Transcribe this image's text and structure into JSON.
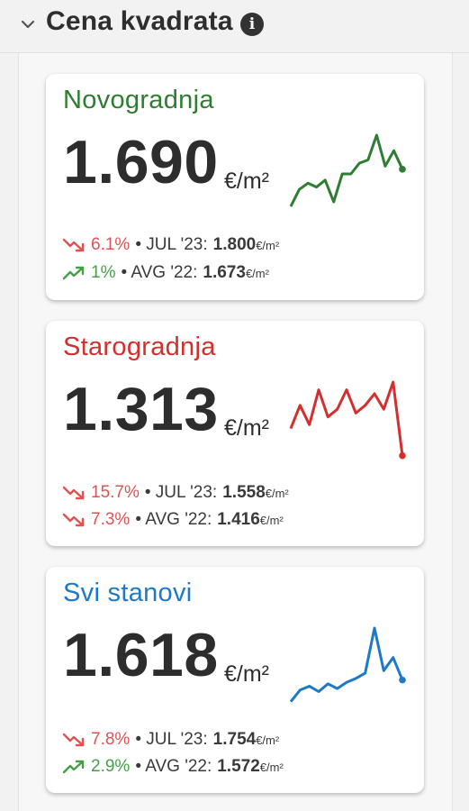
{
  "header": {
    "title": "Cena kvadrata",
    "info_glyph": "i"
  },
  "unit_label": "€/m²",
  "unit_small": "€/m²",
  "cards": [
    {
      "title": "Novogradnja",
      "color": "#2e7d32",
      "price": "1.690",
      "sparkline": [
        0.08,
        0.3,
        0.38,
        0.33,
        0.42,
        0.14,
        0.5,
        0.5,
        0.64,
        0.68,
        1.0,
        0.6,
        0.8,
        0.56
      ],
      "stats": [
        {
          "trend": "down",
          "trend_color": "#e05252",
          "pct": "6.1%",
          "label": "• JUL '23:",
          "value": "1.800"
        },
        {
          "trend": "up",
          "trend_color": "#43a047",
          "pct": "1%",
          "label": "• AVG '22:",
          "value": "1.673"
        }
      ]
    },
    {
      "title": "Starogradnja",
      "color": "#d32f2f",
      "price": "1.313",
      "sparkline": [
        0.4,
        0.7,
        0.45,
        0.9,
        0.55,
        0.65,
        0.9,
        0.6,
        0.7,
        0.85,
        0.65,
        1.0,
        0.05
      ],
      "stats": [
        {
          "trend": "down",
          "trend_color": "#e05252",
          "pct": "15.7%",
          "label": "• JUL '23:",
          "value": "1.558"
        },
        {
          "trend": "down",
          "trend_color": "#e05252",
          "pct": "7.3%",
          "label": "• AVG '22:",
          "value": "1.416"
        }
      ]
    },
    {
      "title": "Svi stanovi",
      "color": "#1e7ac8",
      "price": "1.618",
      "sparkline": [
        0.05,
        0.2,
        0.25,
        0.18,
        0.28,
        0.22,
        0.3,
        0.35,
        0.42,
        1.0,
        0.45,
        0.62,
        0.33
      ],
      "stats": [
        {
          "trend": "down",
          "trend_color": "#e05252",
          "pct": "7.8%",
          "label": "• JUL '23:",
          "value": "1.754"
        },
        {
          "trend": "up",
          "trend_color": "#43a047",
          "pct": "2.9%",
          "label": "• AVG '22:",
          "value": "1.572"
        }
      ]
    }
  ]
}
